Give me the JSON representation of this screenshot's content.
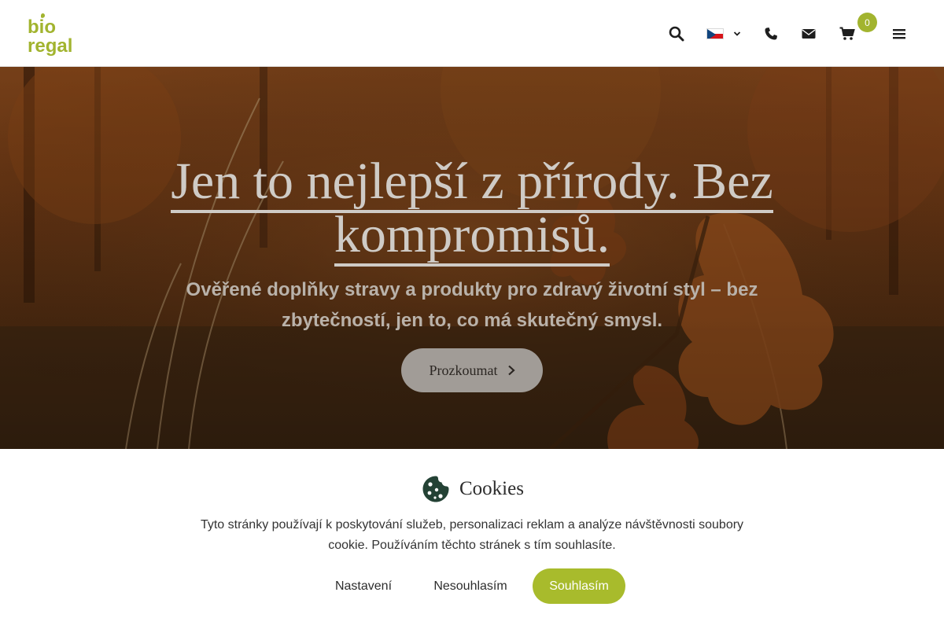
{
  "header": {
    "logo_text": "bio regal",
    "cart_count": "0",
    "icons": {
      "search": "search-icon",
      "language": "czech-flag-icon",
      "phone": "phone-icon",
      "mail": "envelope-icon",
      "cart": "shopping-cart-icon",
      "menu": "hamburger-menu-icon"
    }
  },
  "hero": {
    "title": "Jen to nejlepší z přírody. Bez kompromisů.",
    "subtitle": "Ověřené doplňky stravy a produkty pro zdravý životní styl – bez zbytečností, jen to, co má skutečný smysl.",
    "cta_label": "Prozkoumat"
  },
  "cookies": {
    "title": "Cookies",
    "text": "Tyto stránky používají k poskytování služeb, personalizaci reklam a analýze návštěvnosti soubory cookie. Používáním těchto stránek s tím souhlasíte.",
    "settings_label": "Nastavení",
    "decline_label": "Nesouhlasím",
    "accept_label": "Souhlasím"
  },
  "colors": {
    "brand_green": "#a8bb2c",
    "cookie_icon": "#244235",
    "hero_text": "#cfcbc6"
  }
}
